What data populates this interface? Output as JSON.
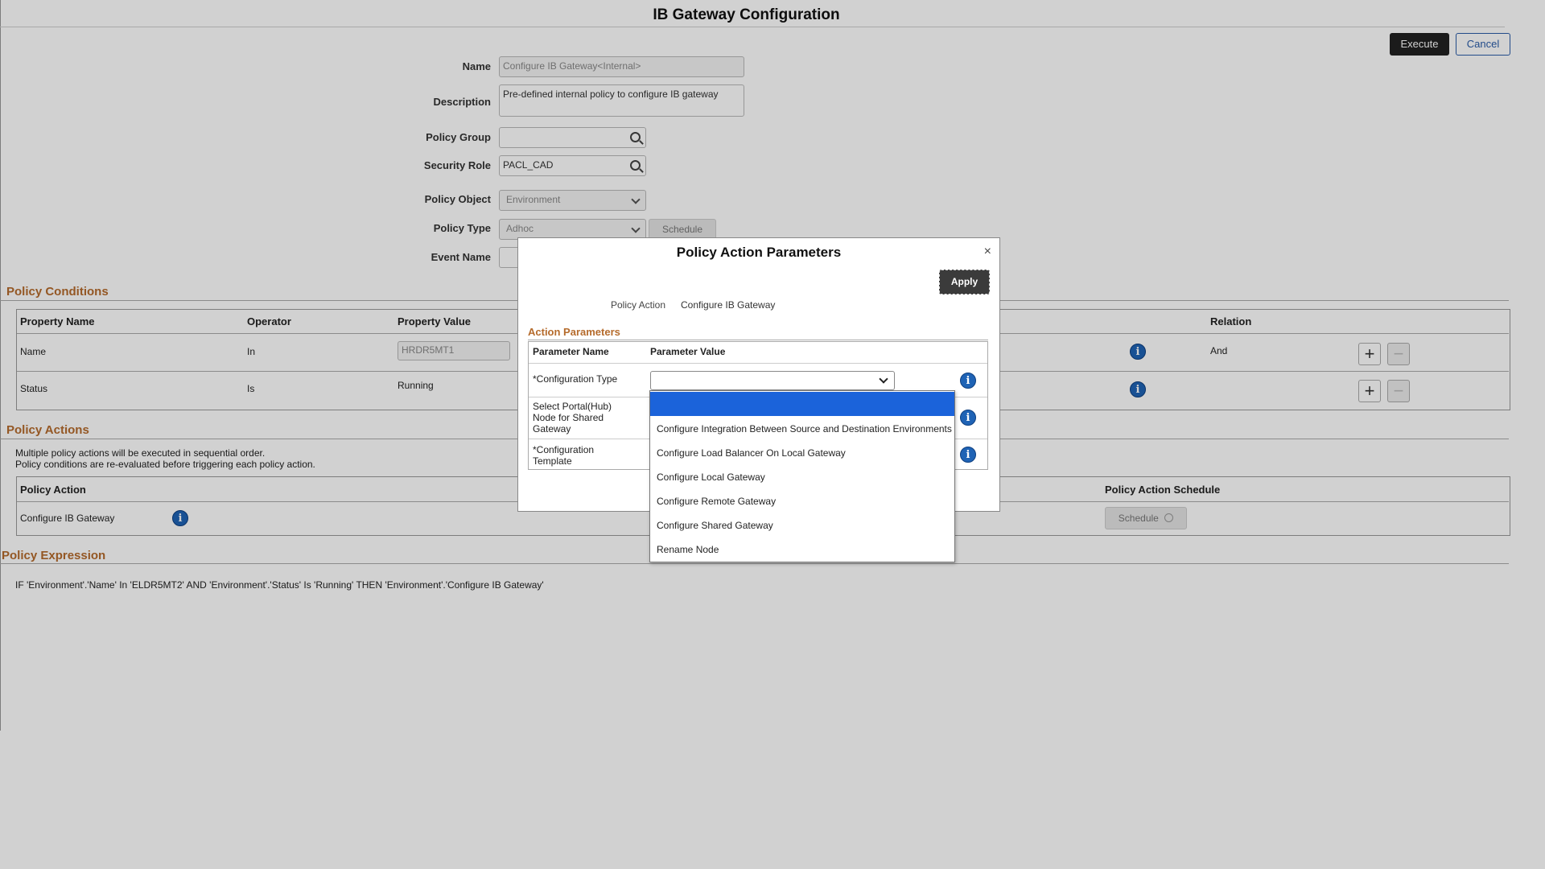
{
  "page": {
    "title": "IB Gateway Configuration",
    "execute_label": "Execute",
    "cancel_label": "Cancel"
  },
  "form": {
    "name_label": "Name",
    "name_value": "Configure IB Gateway<Internal>",
    "description_label": "Description",
    "description_value": "Pre-defined internal policy to configure IB gateway",
    "policy_group_label": "Policy Group",
    "policy_group_value": "",
    "security_role_label": "Security Role",
    "security_role_value": "PACL_CAD",
    "policy_object_label": "Policy Object",
    "policy_object_value": "Environment",
    "policy_type_label": "Policy Type",
    "policy_type_value": "Adhoc",
    "schedule_label": "Schedule",
    "event_name_label": "Event Name"
  },
  "conditions": {
    "section_title": "Policy Conditions",
    "headers": {
      "property_name": "Property Name",
      "operator": "Operator",
      "property_value": "Property Value",
      "relation": "Relation"
    },
    "rows": [
      {
        "property_name": "Name",
        "operator": "In",
        "property_value": "HRDR5MT1",
        "relation": "And"
      },
      {
        "property_name": "Status",
        "operator": "Is",
        "property_value": "Running",
        "relation": ""
      }
    ]
  },
  "actions": {
    "section_title": "Policy Actions",
    "note_line1": "Multiple policy actions will be executed in sequential order.",
    "note_line2": "Policy conditions are re-evaluated before triggering each policy action.",
    "headers": {
      "policy_action": "Policy Action",
      "schedule": "Policy Action Schedule"
    },
    "rows": [
      {
        "policy_action": "Configure IB Gateway",
        "schedule_label": "Schedule"
      }
    ]
  },
  "expression": {
    "section_title": "Policy Expression",
    "text": "IF 'Environment'.'Name' In 'ELDR5MT2' AND 'Environment'.'Status' Is 'Running' THEN 'Environment'.'Configure IB Gateway'"
  },
  "modal": {
    "title": "Policy Action Parameters",
    "close_label": "×",
    "apply_label": "Apply",
    "policy_action_label": "Policy Action",
    "policy_action_value": "Configure IB Gateway",
    "section_title": "Action Parameters",
    "headers": {
      "name": "Parameter Name",
      "value": "Parameter Value"
    },
    "params": [
      {
        "name": "*Configuration Type",
        "value": ""
      },
      {
        "name_line1": "Select Portal(Hub)",
        "name_line2": "Node for Shared",
        "name_line3": "Gateway"
      },
      {
        "name_line1": "*Configuration",
        "name_line2": "Template"
      }
    ]
  },
  "dropdown": {
    "options": [
      "",
      "Configure Integration Between Source and Destination Environments",
      "Configure Load Balancer On Local Gateway",
      "Configure Local Gateway",
      "Configure Remote Gateway",
      "Configure Shared Gateway",
      "Rename Node"
    ],
    "selected_index": 0
  },
  "colors": {
    "accent": "#b56b2c",
    "info_icon": "#1f63b5",
    "dropdown_selected": "#1b63da",
    "overlay": "#b8b8b8"
  }
}
